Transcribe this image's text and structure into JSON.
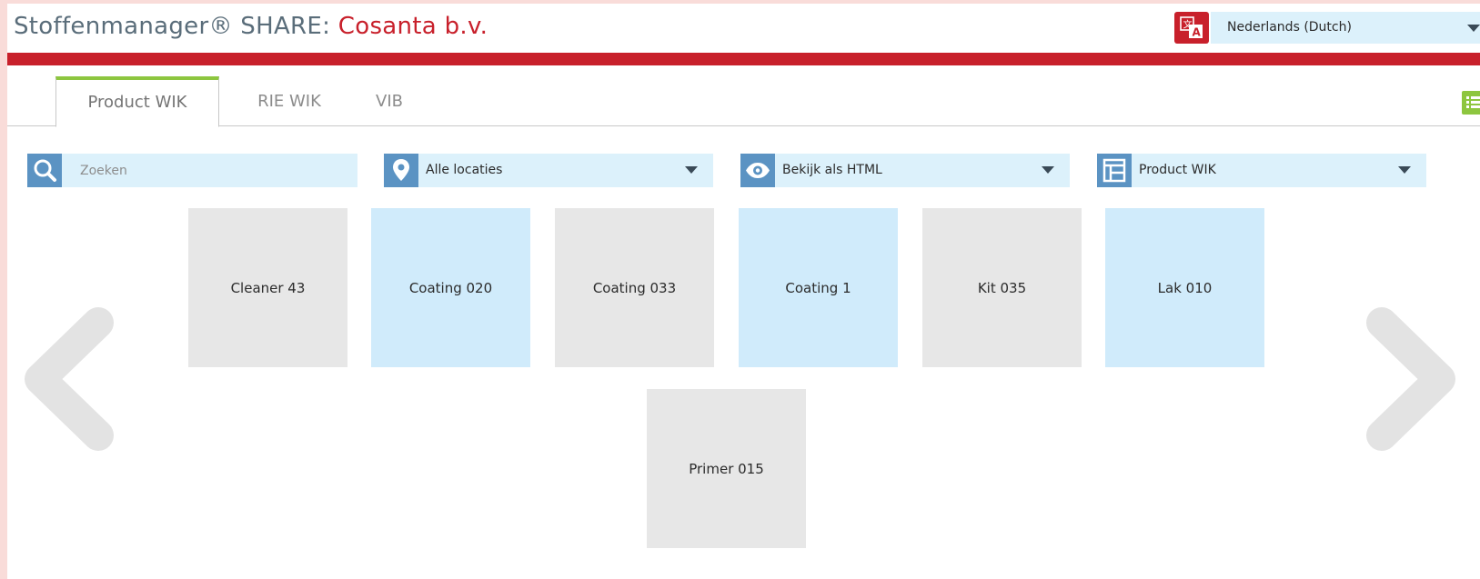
{
  "header": {
    "brand_prefix": "Stoffenmanager® SHARE: ",
    "brand_org": "Cosanta b.v.",
    "language": "Nederlands (Dutch)"
  },
  "tabs": [
    {
      "label": "Product WIK",
      "active": true
    },
    {
      "label": "RIE WIK",
      "active": false
    },
    {
      "label": "VIB",
      "active": false
    }
  ],
  "filters": {
    "search_placeholder": "Zoeken",
    "search_value": "",
    "location": "Alle locaties",
    "view": "Bekijk als HTML",
    "document_type": "Product WIK"
  },
  "products": [
    {
      "label": "Cleaner 43",
      "color": "#e7e7e7"
    },
    {
      "label": "Coating 020",
      "color": "#d0ebfb"
    },
    {
      "label": "Coating 033",
      "color": "#e7e7e7"
    },
    {
      "label": "Coating 1",
      "color": "#d0ebfb"
    },
    {
      "label": "Kit 035",
      "color": "#e7e7e7"
    },
    {
      "label": "Lak 010",
      "color": "#d0ebfb"
    },
    {
      "label": "Primer 015",
      "color": "#e7e7e7"
    }
  ],
  "colors": {
    "brand_red": "#c8202b",
    "accent_green": "#8dc63f",
    "icon_blue": "#5b93c3",
    "field_bg": "#dcf1fb"
  }
}
